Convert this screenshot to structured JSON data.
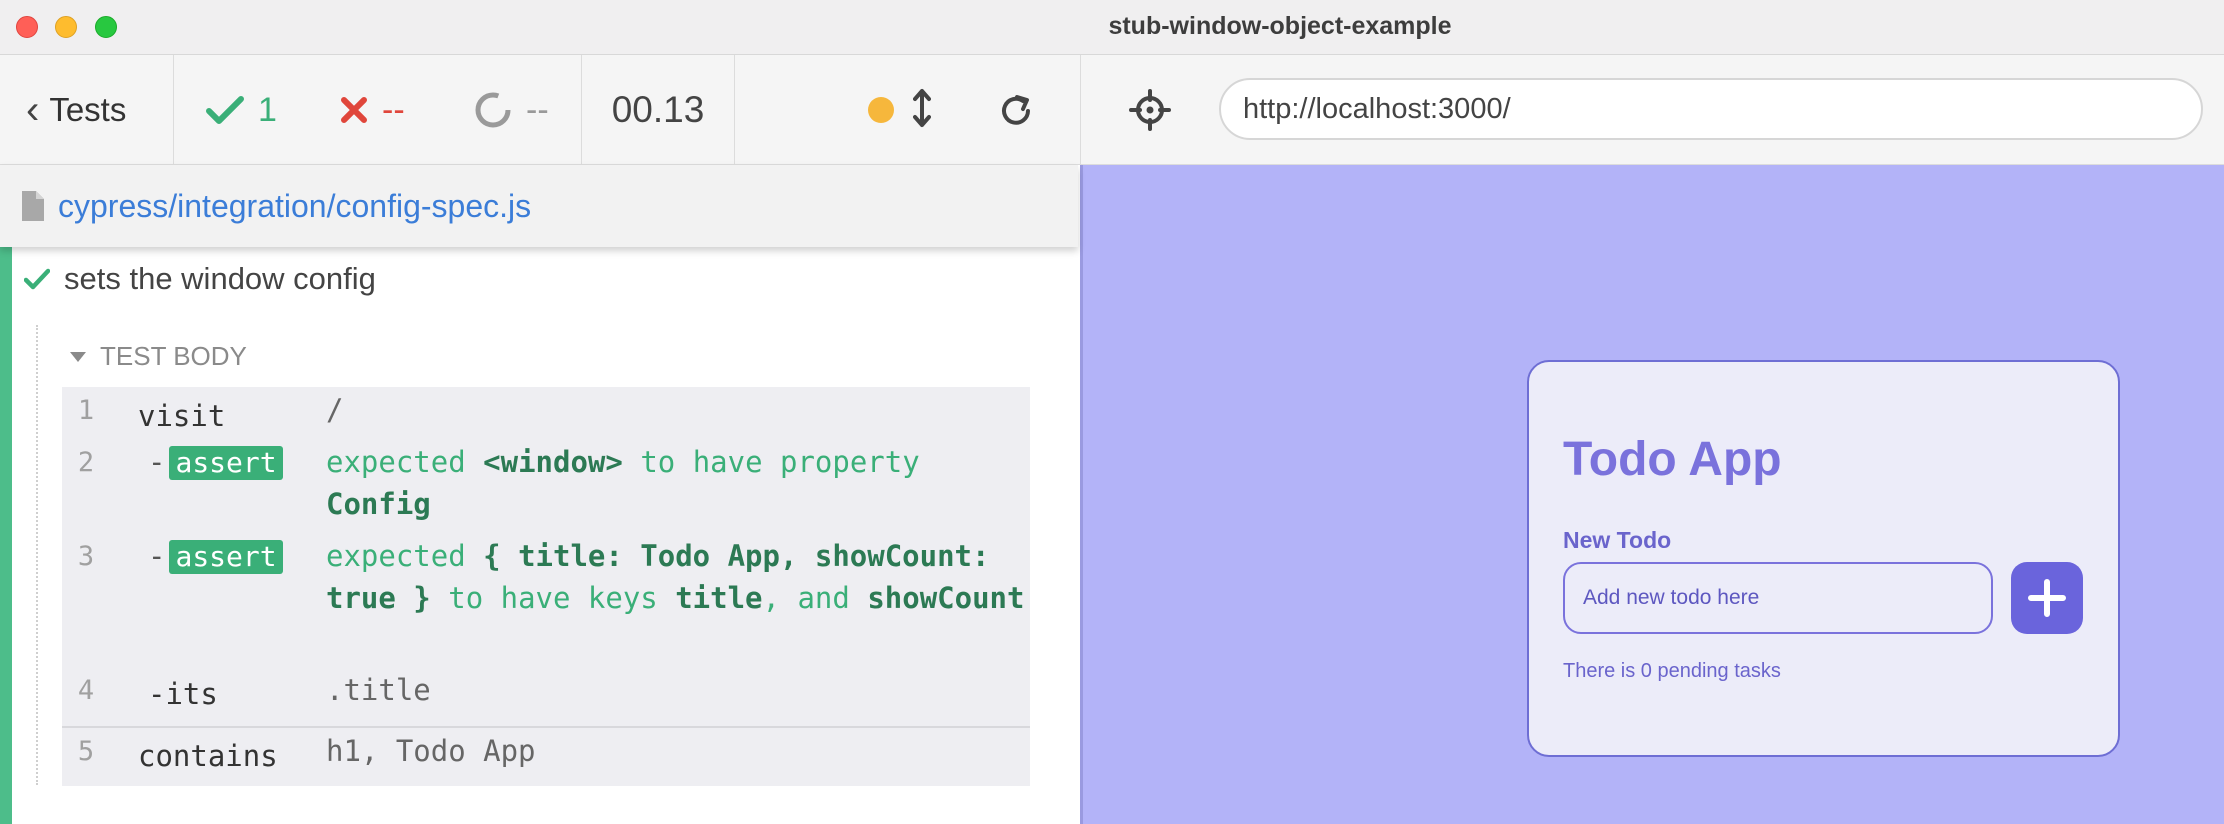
{
  "window": {
    "title": "stub-window-object-example"
  },
  "header": {
    "back_label": "Tests",
    "passed": "1",
    "failed": "--",
    "pending": "--",
    "duration": "00.13"
  },
  "spec": {
    "path": "cypress/integration/config-spec.js"
  },
  "test": {
    "title": "sets the window config",
    "body_label": "TEST BODY",
    "commands": [
      {
        "num": "1",
        "name": "visit",
        "message": "/"
      },
      {
        "num": "2",
        "name": "-",
        "badge": "assert",
        "msg_a": "expected",
        "msg_b": "<window>",
        "msg_c": "to have property",
        "msg_d": "Config"
      },
      {
        "num": "3",
        "name": "-",
        "badge": "assert",
        "msg_a": "expected",
        "msg_b": "{ title: Todo App, showCount: true }",
        "msg_c": "to have keys",
        "msg_d": "title",
        "msg_e": ", and",
        "msg_f": "showCount"
      },
      {
        "num": "4",
        "name": "-its",
        "message": ".title"
      },
      {
        "num": "5",
        "name": "contains",
        "message": "h1, Todo App"
      }
    ]
  },
  "browser": {
    "url": "http://localhost:3000/"
  },
  "app": {
    "title": "Todo App",
    "new_todo_label": "New Todo",
    "input_placeholder": "Add new todo here",
    "pending_text": "There is 0 pending tasks"
  },
  "colors": {
    "pass": "#3aaf78",
    "fail": "#e0463b",
    "link": "#3b7dd8",
    "viewport_bg": "#b3b3f8",
    "app_accent": "#7a72dc"
  }
}
